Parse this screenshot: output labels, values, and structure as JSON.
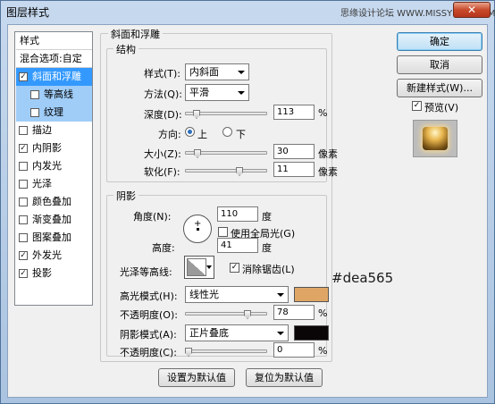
{
  "window": {
    "title": "图层样式",
    "watermark": "思缘设计论坛 WWW.MISSYUAN.COM",
    "close_glyph": "✕"
  },
  "sidebar": {
    "items": [
      {
        "label": "样式",
        "kind": "head",
        "checked": false
      },
      {
        "label": "混合选项:自定",
        "kind": "head",
        "checked": false
      },
      {
        "label": "斜面和浮雕",
        "kind": "item",
        "checked": true,
        "selected": true
      },
      {
        "label": "等高线",
        "kind": "sub",
        "checked": false
      },
      {
        "label": "纹理",
        "kind": "sub",
        "checked": false
      },
      {
        "label": "描边",
        "kind": "item",
        "checked": false
      },
      {
        "label": "内阴影",
        "kind": "item",
        "checked": true
      },
      {
        "label": "内发光",
        "kind": "item",
        "checked": false
      },
      {
        "label": "光泽",
        "kind": "item",
        "checked": false
      },
      {
        "label": "颜色叠加",
        "kind": "item",
        "checked": false
      },
      {
        "label": "渐变叠加",
        "kind": "item",
        "checked": false
      },
      {
        "label": "图案叠加",
        "kind": "item",
        "checked": false
      },
      {
        "label": "外发光",
        "kind": "item",
        "checked": true
      },
      {
        "label": "投影",
        "kind": "item",
        "checked": true
      }
    ]
  },
  "bevel": {
    "group_title": "斜面和浮雕",
    "structure_title": "结构",
    "style_label": "样式(T):",
    "style_value": "内斜面",
    "technique_label": "方法(Q):",
    "technique_value": "平滑",
    "depth_label": "深度(D):",
    "depth_value": "113",
    "depth_unit": "%",
    "depth_level": 0.11,
    "direction_label": "方向:",
    "dir_up": "上",
    "dir_down": "下",
    "direction": "上",
    "size_label": "大小(Z):",
    "size_value": "30",
    "size_unit": "像素",
    "size_level": 0.12,
    "soften_label": "软化(F):",
    "soften_value": "11",
    "soften_unit": "像素",
    "soften_level": 0.68
  },
  "shading": {
    "title": "阴影",
    "angle_label": "角度(N):",
    "angle_value": "110",
    "angle_unit": "度",
    "global_light_label": "使用全局光(G)",
    "global_light": false,
    "altitude_label": "高度:",
    "altitude_value": "41",
    "altitude_unit": "度",
    "gloss_label": "光泽等高线:",
    "antialias_label": "消除锯齿(L)",
    "antialias": true,
    "highlight_mode_label": "高光模式(H):",
    "highlight_mode_value": "线性光",
    "highlight_color": "#dea565",
    "highlight_opacity_label": "不透明度(O):",
    "highlight_opacity_value": "78",
    "highlight_opacity_unit": "%",
    "highlight_opacity_level": 0.78,
    "shadow_mode_label": "阴影模式(A):",
    "shadow_mode_value": "正片叠底",
    "shadow_color": "#0a0506",
    "shadow_opacity_label": "不透明度(C):",
    "shadow_opacity_value": "0",
    "shadow_opacity_unit": "%",
    "shadow_opacity_level": 0.0
  },
  "footer": {
    "set_default": "设置为默认值",
    "reset_default": "复位为默认值"
  },
  "right": {
    "ok": "确定",
    "cancel": "取消",
    "new_style": "新建样式(W)...",
    "preview_label": "预览(V)",
    "preview": true
  },
  "annotation": {
    "color_hex": "#dea565"
  }
}
